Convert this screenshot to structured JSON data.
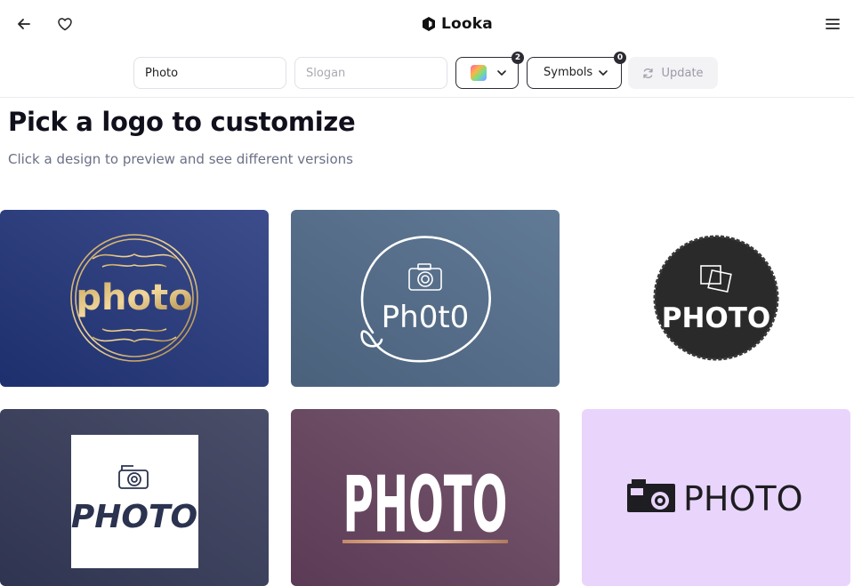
{
  "brand": {
    "name": "Looka"
  },
  "toolbar": {
    "company_name_value": "Photo",
    "slogan_placeholder": "Slogan",
    "colors_count": "2",
    "symbols_label": "Symbols",
    "symbols_count": "0",
    "update_label": "Update"
  },
  "main": {
    "title": "Pick a logo to customize",
    "subtitle": "Click a design to preview and see different versions"
  },
  "logos": [
    {
      "text": "photo",
      "background": "#2d3d7a"
    },
    {
      "text": "Ph0t0",
      "background": "#4f6984"
    },
    {
      "text": "PHOTO",
      "background": "#ffffff"
    },
    {
      "text": "PHOTO",
      "background": "#3b4059"
    },
    {
      "text": "PHOTO",
      "background": "#6a4a62"
    },
    {
      "text": "PHOTO",
      "background": "#e9d5fb"
    }
  ]
}
